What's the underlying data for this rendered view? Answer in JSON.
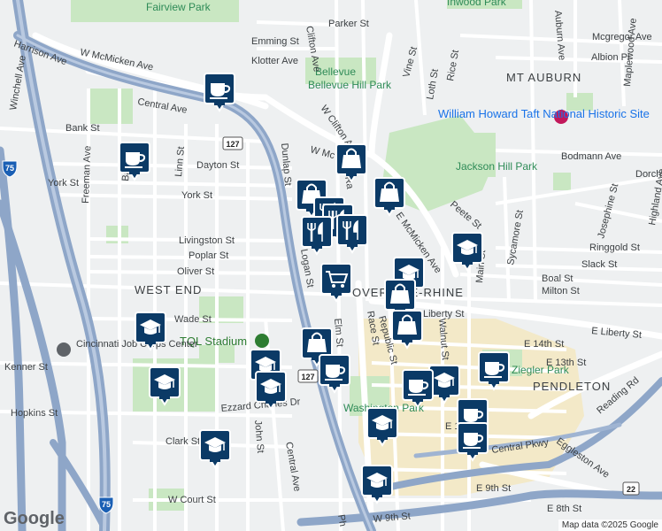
{
  "neighborhoods": [
    "WEST END",
    "OVER-THE-RHINE",
    "MT AUBURN",
    "PENDLETON"
  ],
  "parks": [
    "Fairview Park",
    "Bellevue Hill Park",
    "Jackson Hill Park",
    "Inwood Park",
    "Washington Park",
    "Ziegler Park"
  ],
  "pois": [
    "William Howard Taft National Historic Site",
    "TQL Stadium",
    "Cincinnati Job Corps Center"
  ],
  "streets": {
    "w_mcmicken": "W McMicken Ave",
    "central_ave": "Central Ave",
    "central_ave2": "Central Ave",
    "harrison": "Harrison Ave",
    "winchell": "Winchell Ave",
    "bank": "Bank St",
    "dayton": "Dayton St",
    "york_w": "York St",
    "york": "York St",
    "freeman": "Freeman Ave",
    "linn": "Linn St",
    "dunlap": "Dunlap St",
    "livingston": "Livingston St",
    "poplar": "Poplar St",
    "oliver": "Oliver St",
    "logan": "Logan St",
    "wade": "Wade St",
    "kenner": "Kenner St",
    "hopkins": "Hopkins St",
    "ezzard": "Ezzard Charles Dr",
    "clark": "Clark St",
    "john": "John St",
    "w_court": "W Court St",
    "elm": "Elm St",
    "race": "Race St",
    "vine": "Vine St",
    "republic": "Republic St",
    "walnut": "Walnut St",
    "main": "Main St",
    "liberty": "Liberty St",
    "e_liberty": "E Liberty St",
    "e_14th": "E 14th St",
    "e_13th": "E 13th St",
    "e_12th": "E 12th St",
    "central_pkwy": "Central Pkwy",
    "e_9th": "E 9th St",
    "w_9th": "W 9th St",
    "e_8th": "E 8th St",
    "reading": "Reading Rd",
    "eggleston": "Eggleston Ave",
    "sycamore": "Sycamore St",
    "boal": "Boal St",
    "milton": "Milton St",
    "slack": "Slack St",
    "ringgold": "Ringgold St",
    "josephine": "Josephine St",
    "highland": "Highland Ave",
    "bodmann": "Bodmann Ave",
    "peete": "Peete St",
    "e_mcmicken": "E McMicken Ave",
    "w_clifton": "W Clifton Ave",
    "clifton": "Clifton Ave",
    "loth": "Loth St",
    "rice": "Rice St",
    "auburn": "Auburn Ave",
    "maplewood": "Maplewood Ave",
    "mcgregor": "Mcgregor Ave",
    "albion": "Albion Pl",
    "parker": "Parker St",
    "emming": "Emming St",
    "klotter": "Klotter Ave",
    "dorchester": "Dorche",
    "bay": "Bay",
    "ra": "Ra",
    "w_mc_cut": "W Mc",
    "ph": "Ph"
  },
  "shields": [
    "75",
    "75",
    "127",
    "127",
    "22"
  ],
  "google_logo": "Google",
  "attribution": "Map data ©2025 Google",
  "colors": {
    "pin": "#0b3a66",
    "highway": "#8ea6c8",
    "park": "#c9e7c2",
    "downtown": "#f2e7c5"
  }
}
